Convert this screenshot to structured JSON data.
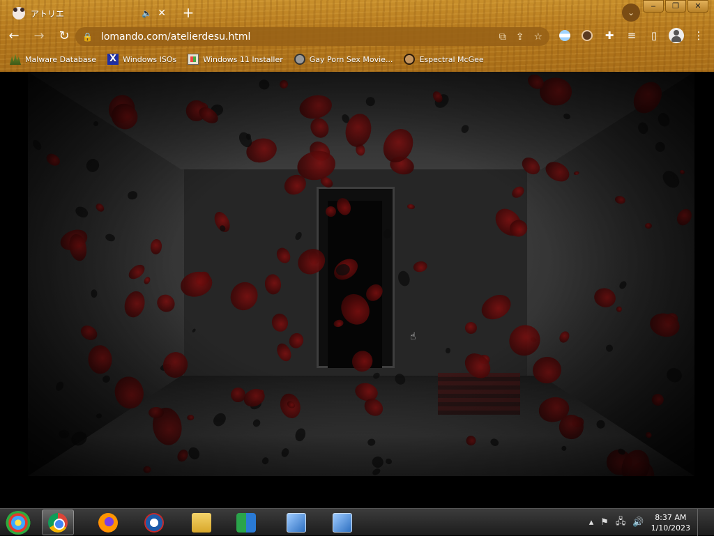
{
  "browser": {
    "tab": {
      "title": "アトリエ",
      "audio_icon": "speaker-icon",
      "close": "✕"
    },
    "new_tab": "+",
    "window_controls": {
      "minimize": "‒",
      "restore": "❐",
      "close": "✕"
    },
    "profile_menu": "⌄",
    "nav": {
      "back": "←",
      "forward": "→",
      "reload": "↻"
    },
    "address": {
      "url": "lomando.com/atelierdesu.html",
      "lock": "🔒"
    },
    "omnibox_icons": {
      "translate": "⧉",
      "share": "⇪",
      "bookmark": "☆"
    },
    "extensions": {
      "puzzle": "✚",
      "media": "≡",
      "sidepanel": "▯",
      "menu": "⋮"
    },
    "bookmarks": [
      {
        "label": "Malware Database",
        "icon": "grass-icon"
      },
      {
        "label": "Windows ISOs",
        "icon": "x-icon"
      },
      {
        "label": "Windows 11 Installer",
        "icon": "windows-installer-icon"
      },
      {
        "label": "Gay Porn Sex Movie...",
        "icon": "globe-icon"
      },
      {
        "label": "Espectral McGee",
        "icon": "face-icon"
      }
    ],
    "theme_color": "#b67a1e"
  },
  "page": {
    "scene": "blood-splattered room",
    "accent_blood": "#7a0f0f",
    "cursor": "☝"
  },
  "taskbar": {
    "apps": [
      "start",
      "chrome",
      "firefox",
      "obama",
      "file-explorer",
      "people",
      "setup-1",
      "setup-2"
    ],
    "tray": {
      "chevron": "▴",
      "flag": "⚑",
      "network": "🖧",
      "volume": "🔊"
    },
    "clock": {
      "time": "8:37 AM",
      "date": "1/10/2023"
    }
  }
}
